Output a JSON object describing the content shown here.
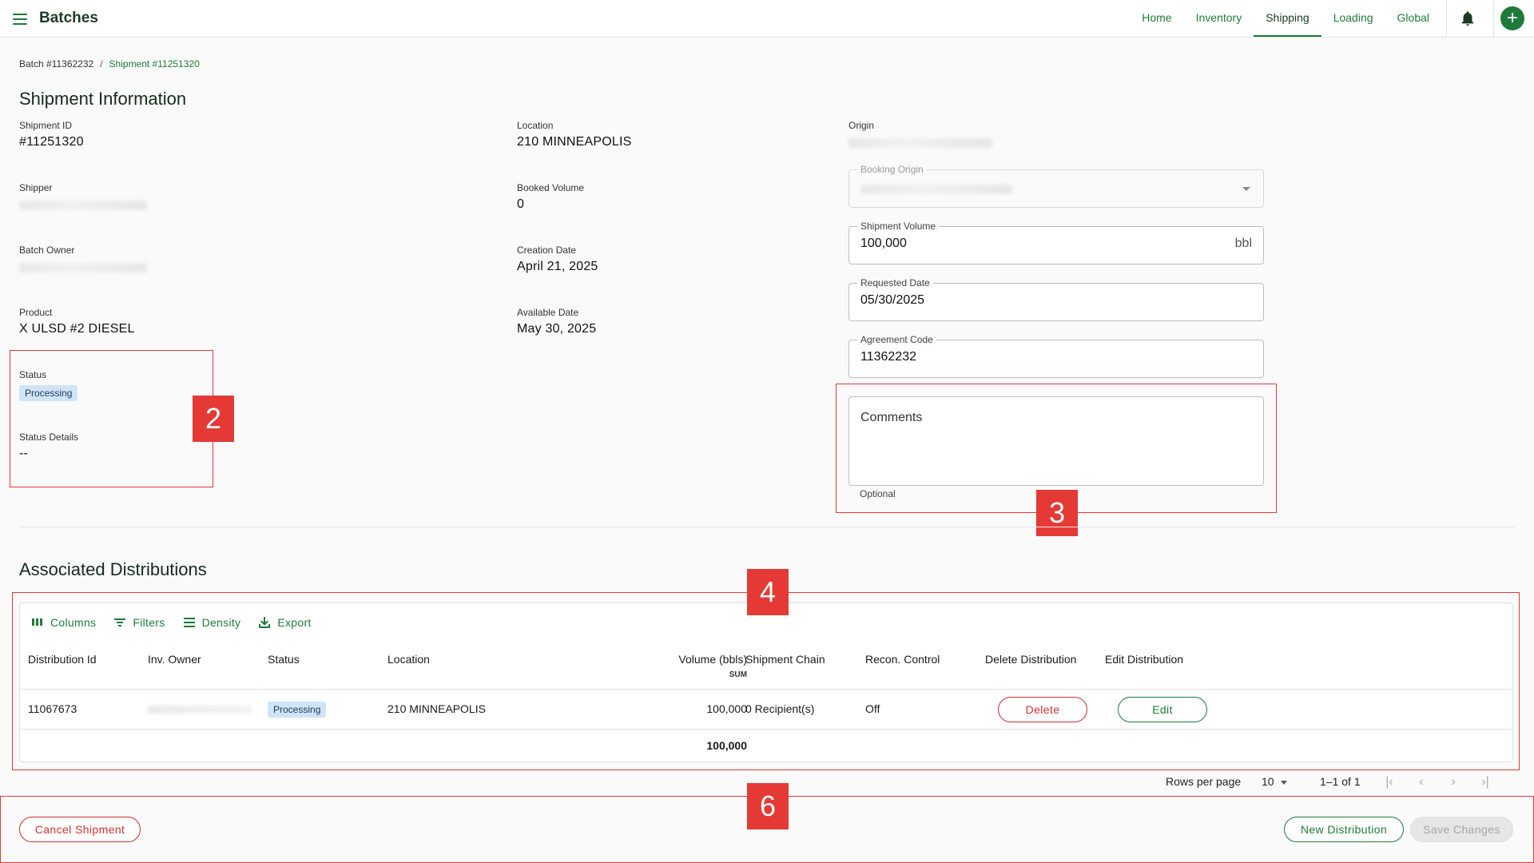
{
  "app": {
    "title": "Batches"
  },
  "nav": {
    "items": [
      "Home",
      "Inventory",
      "Shipping",
      "Loading",
      "Global"
    ],
    "active": "Shipping"
  },
  "breadcrumb": {
    "batch": "Batch #11362232",
    "separator": "/",
    "shipment": "Shipment #11251320"
  },
  "shipment_info": {
    "title": "Shipment Information",
    "shipment_id": {
      "label": "Shipment ID",
      "value": "#11251320"
    },
    "shipper": {
      "label": "Shipper"
    },
    "batch_owner": {
      "label": "Batch Owner"
    },
    "product": {
      "label": "Product",
      "value": "X ULSD #2 DIESEL"
    },
    "status": {
      "label": "Status",
      "value": "Processing"
    },
    "status_details": {
      "label": "Status Details",
      "value": "--"
    },
    "location": {
      "label": "Location",
      "value": "210 MINNEAPOLIS"
    },
    "booked_volume": {
      "label": "Booked Volume",
      "value": "0"
    },
    "creation_date": {
      "label": "Creation Date",
      "value": "April 21, 2025"
    },
    "available_date": {
      "label": "Available Date",
      "value": "May 30, 2025"
    },
    "origin": {
      "label": "Origin"
    }
  },
  "form": {
    "booking_origin": {
      "label": "Booking Origin"
    },
    "shipment_volume": {
      "label": "Shipment Volume",
      "value": "100,000",
      "unit": "bbl"
    },
    "requested_date": {
      "label": "Requested Date",
      "value": "05/30/2025"
    },
    "agreement_code": {
      "label": "Agreement Code",
      "value": "11362232"
    },
    "comments": {
      "placeholder": "Comments",
      "helper": "Optional"
    }
  },
  "annotations": {
    "badge_2": "2",
    "badge_3": "3",
    "badge_4": "4",
    "badge_6": "6"
  },
  "distributions": {
    "title": "Associated Distributions",
    "toolbar": {
      "columns": "Columns",
      "filters": "Filters",
      "density": "Density",
      "export": "Export"
    },
    "headers": {
      "distribution_id": "Distribution Id",
      "inv_owner": "Inv. Owner",
      "status": "Status",
      "location": "Location",
      "volume": "Volume (bbls)",
      "volume_agg": "SUM",
      "shipment_chain": "Shipment Chain",
      "recon_control": "Recon. Control",
      "delete_distribution": "Delete Distribution",
      "edit_distribution": "Edit Distribution"
    },
    "rows": [
      {
        "distribution_id": "11067673",
        "status": "Processing",
        "location": "210 MINNEAPOLIS",
        "volume": "100,000",
        "shipment_chain": "0 Recipient(s)",
        "recon_control": "Off",
        "delete_label": "Delete",
        "edit_label": "Edit"
      }
    ],
    "sum": "100,000"
  },
  "pagination": {
    "rows_per_page_label": "Rows per page",
    "rows_per_page": "10",
    "range": "1–1 of 1"
  },
  "actions": {
    "cancel": "Cancel Shipment",
    "new_distribution": "New Distribution",
    "save": "Save Changes"
  },
  "colors": {
    "accent": "#1f7a3a",
    "danger": "#d32f2f",
    "annotation": "#e53935",
    "chip": "#cfe4f7"
  }
}
